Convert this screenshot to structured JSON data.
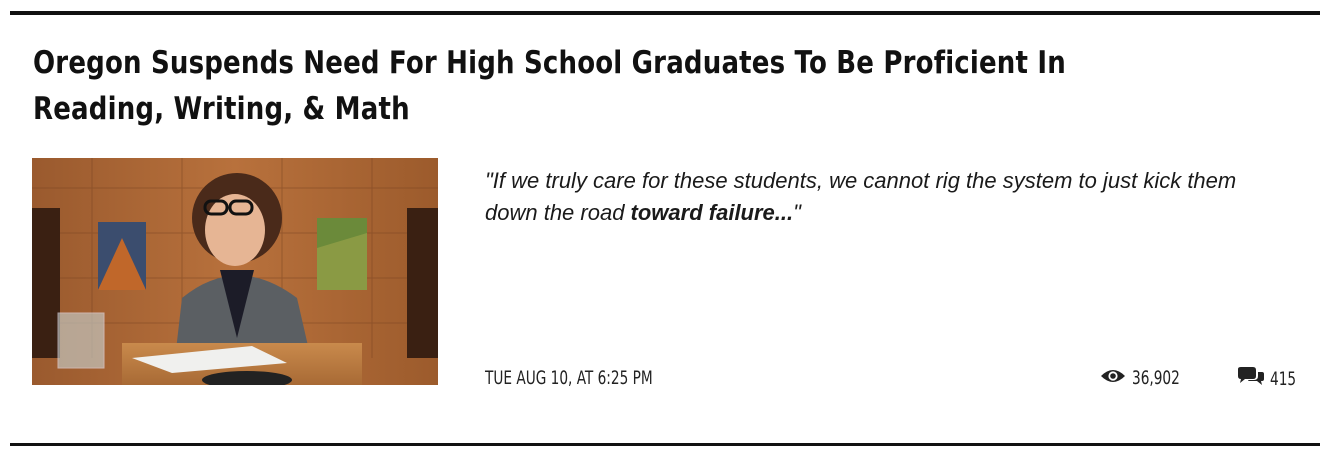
{
  "article": {
    "title": "Oregon Suspends Need For High School Graduates To Be Proficient In Reading, Writing, & Math",
    "excerpt_prefix": "\"If we truly care for these students, we cannot rig the system to just kick them down the road ",
    "excerpt_bold": "toward failure...",
    "excerpt_suffix": "\"",
    "date": "TUE AUG 10, AT 6:25 PM",
    "views": "36,902",
    "comments": "415"
  },
  "icons": {
    "views": "eye-icon",
    "comments": "comments-icon"
  },
  "colors": {
    "text": "#111111",
    "rule": "#111111",
    "background": "#ffffff"
  }
}
